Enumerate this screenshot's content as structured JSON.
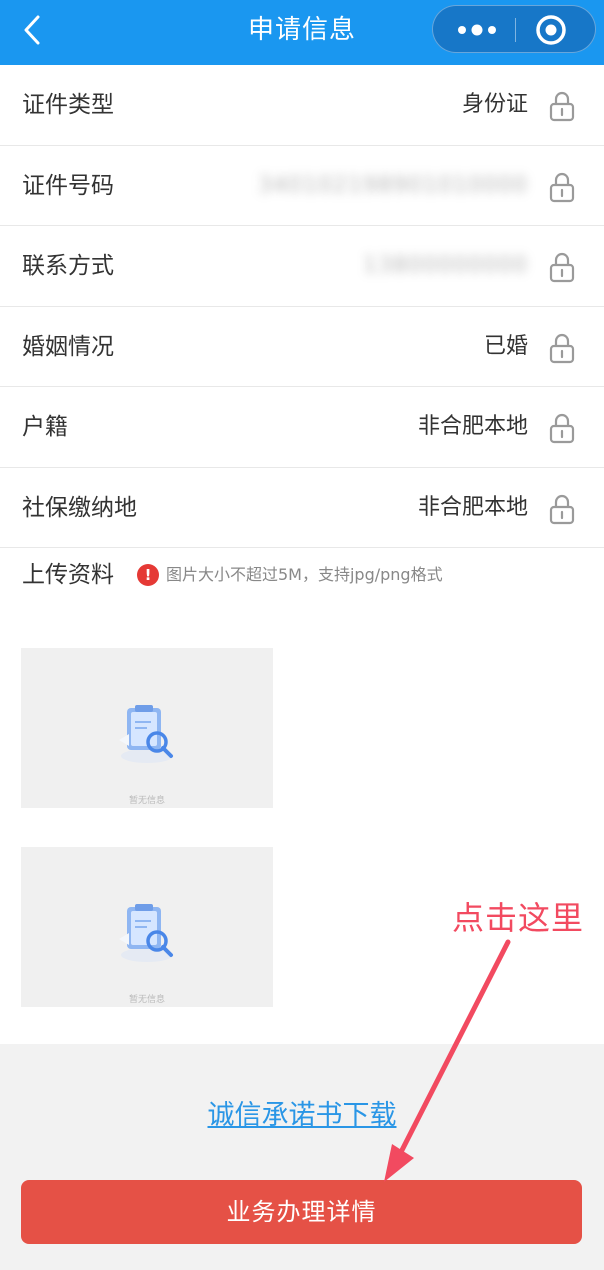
{
  "header": {
    "title": "申请信息",
    "back_icon": "chevron-left-icon",
    "more_icon": "more-dots-icon",
    "close_icon": "target-circle-icon"
  },
  "info_rows": [
    {
      "label": "证件类型",
      "value": "身份证",
      "blurred": false
    },
    {
      "label": "证件号码",
      "value": "340102198901010000",
      "blurred": true
    },
    {
      "label": "联系方式",
      "value": "13800000000",
      "blurred": true
    },
    {
      "label": "婚姻情况",
      "value": "已婚",
      "blurred": false
    },
    {
      "label": "户籍",
      "value": "非合肥本地",
      "blurred": false
    },
    {
      "label": "社保缴纳地",
      "value": "非合肥本地",
      "blurred": false
    }
  ],
  "upload": {
    "title": "上传资料",
    "hint": "图片大小不超过5M，支持jpg/png格式",
    "placeholders": [
      {
        "empty_text": "暂无信息"
      },
      {
        "empty_text": "暂无信息"
      }
    ]
  },
  "bottom": {
    "download_link": "诚信承诺书下载",
    "main_button": "业务办理详情"
  },
  "annotation": {
    "text": "点击这里"
  },
  "colors": {
    "header": "#1a97f0",
    "link": "#2a96e6",
    "button": "#e55146",
    "annotation": "#f24a60"
  }
}
